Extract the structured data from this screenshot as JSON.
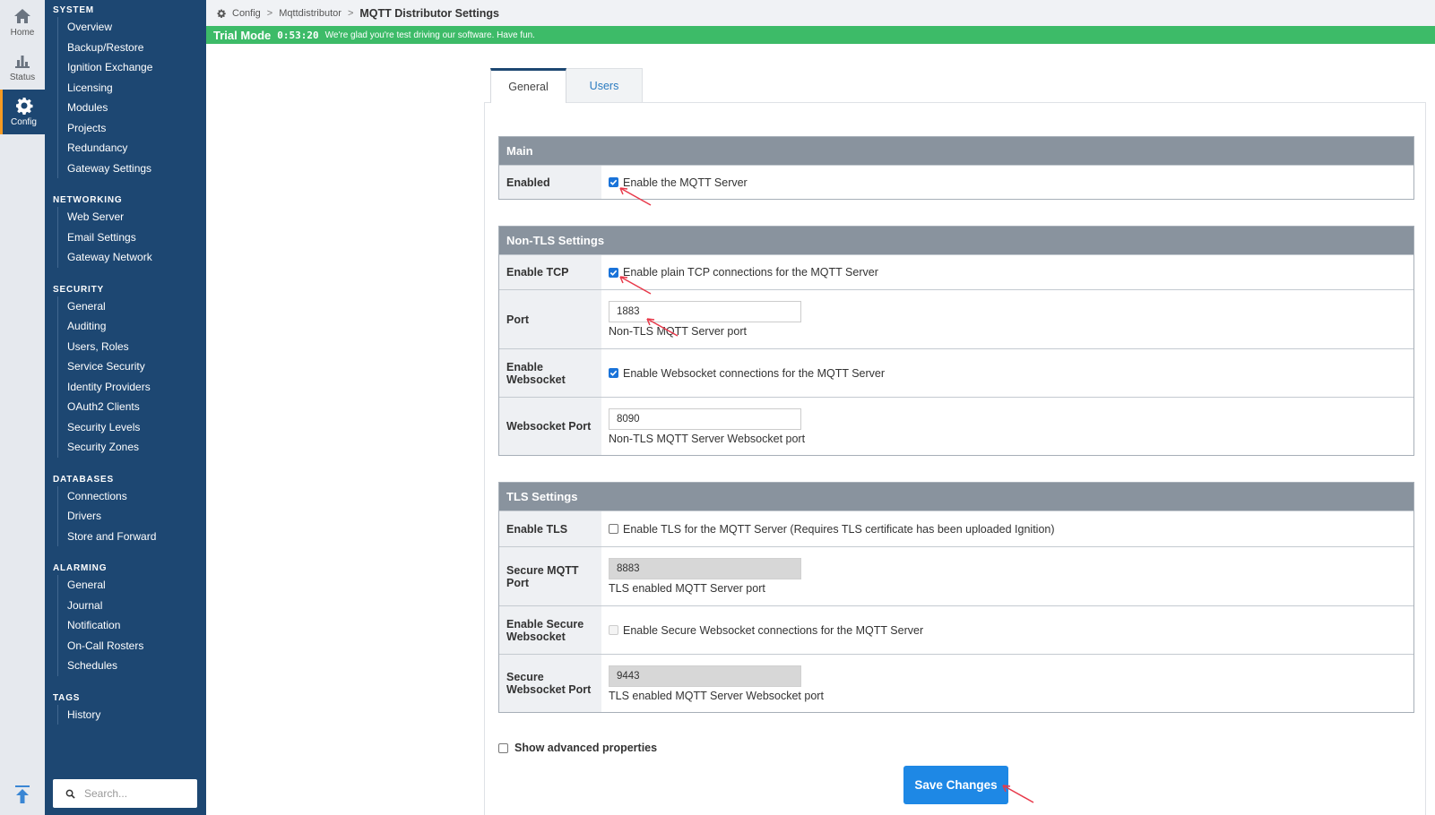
{
  "rail": {
    "items": [
      {
        "label": "Home",
        "icon": "home-icon"
      },
      {
        "label": "Status",
        "icon": "status-chart-icon"
      },
      {
        "label": "Config",
        "icon": "gear-icon",
        "active": true
      }
    ]
  },
  "sidebar": {
    "sections": [
      {
        "title": "SYSTEM",
        "items": [
          "Overview",
          "Backup/Restore",
          "Ignition Exchange",
          "Licensing",
          "Modules",
          "Projects",
          "Redundancy",
          "Gateway Settings"
        ]
      },
      {
        "title": "NETWORKING",
        "items": [
          "Web Server",
          "Email Settings",
          "Gateway Network"
        ]
      },
      {
        "title": "SECURITY",
        "items": [
          "General",
          "Auditing",
          "Users, Roles",
          "Service Security",
          "Identity Providers",
          "OAuth2 Clients",
          "Security Levels",
          "Security Zones"
        ]
      },
      {
        "title": "DATABASES",
        "items": [
          "Connections",
          "Drivers",
          "Store and Forward"
        ]
      },
      {
        "title": "ALARMING",
        "items": [
          "General",
          "Journal",
          "Notification",
          "On-Call Rosters",
          "Schedules"
        ]
      },
      {
        "title": "TAGS",
        "items": [
          "History"
        ]
      }
    ],
    "search_placeholder": "Search..."
  },
  "breadcrumb": {
    "root": "Config",
    "parent": "Mqttdistributor",
    "current": "MQTT Distributor Settings",
    "separator": ">"
  },
  "trial": {
    "label": "Trial Mode",
    "timer": "0:53:20",
    "message": "We're glad you're test driving our software. Have fun."
  },
  "tabs": [
    {
      "label": "General",
      "active": true
    },
    {
      "label": "Users",
      "active": false
    }
  ],
  "sections": {
    "main": {
      "title": "Main",
      "enabled": {
        "label": "Enabled",
        "checkbox_label": "Enable the MQTT Server",
        "checked": true
      }
    },
    "non_tls": {
      "title": "Non-TLS Settings",
      "enable_tcp": {
        "label": "Enable TCP",
        "checkbox_label": "Enable plain TCP connections for the MQTT Server",
        "checked": true
      },
      "port": {
        "label": "Port",
        "value": "1883",
        "hint": "Non-TLS MQTT Server port"
      },
      "enable_websocket": {
        "label": "Enable Websocket",
        "checkbox_label": "Enable Websocket connections for the MQTT Server",
        "checked": true
      },
      "websocket_port": {
        "label": "Websocket Port",
        "value": "8090",
        "hint": "Non-TLS MQTT Server Websocket port"
      }
    },
    "tls": {
      "title": "TLS Settings",
      "enable_tls": {
        "label": "Enable TLS",
        "checkbox_label": "Enable TLS for the MQTT Server (Requires TLS certificate has been uploaded Ignition)",
        "checked": false
      },
      "secure_port": {
        "label": "Secure MQTT Port",
        "value": "8883",
        "hint": "TLS enabled MQTT Server port"
      },
      "enable_secure_websocket": {
        "label": "Enable Secure Websocket",
        "checkbox_label": "Enable Secure Websocket connections for the MQTT Server",
        "checked": false
      },
      "secure_websocket_port": {
        "label": "Secure Websocket Port",
        "value": "9443",
        "hint": "TLS enabled MQTT Server Websocket port"
      }
    }
  },
  "advanced": {
    "label": "Show advanced properties",
    "checked": false
  },
  "save_label": "Save Changes",
  "colors": {
    "sidebar": "#1d4772",
    "trial": "#3dbb68",
    "primary_button": "#1e88e5",
    "section_header": "#89939e",
    "annotation_arrow": "#e8394a"
  }
}
